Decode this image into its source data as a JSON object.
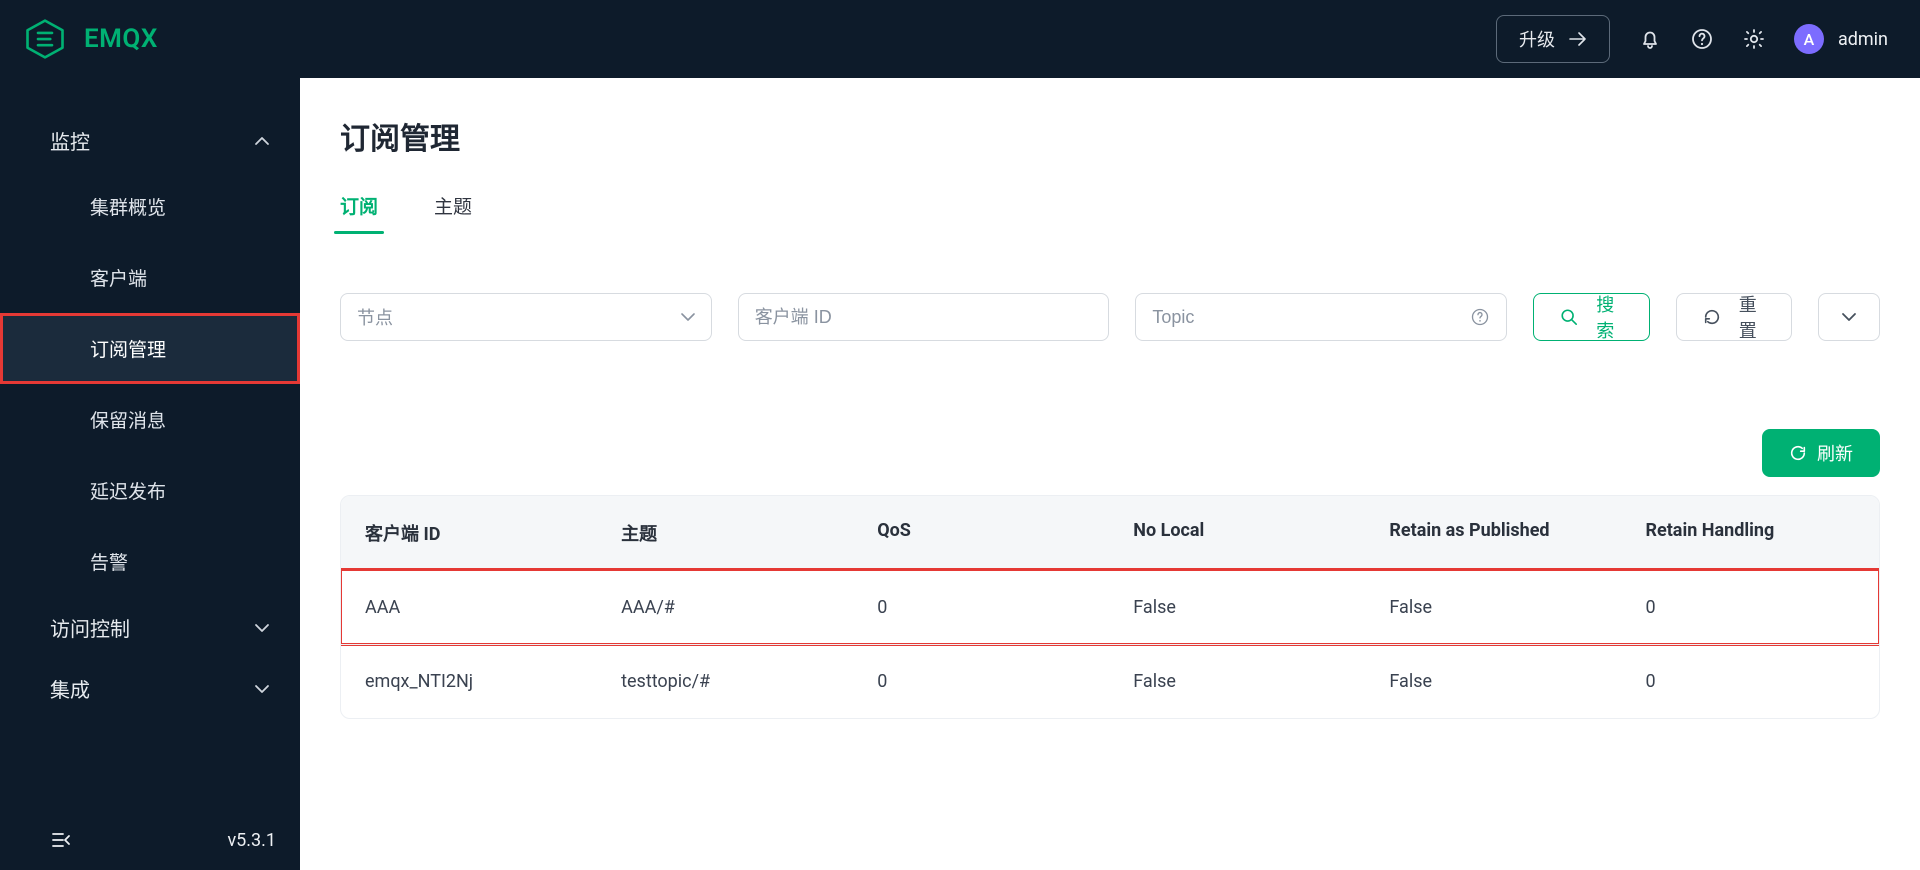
{
  "brand": {
    "name": "EMQX"
  },
  "header": {
    "upgrade_label": "升级",
    "user_initial": "A",
    "user_name": "admin"
  },
  "sidebar": {
    "sections": [
      {
        "label": "监控",
        "expanded": true,
        "items": [
          {
            "label": "集群概览"
          },
          {
            "label": "客户端"
          },
          {
            "label": "订阅管理",
            "active": true,
            "highlight": true
          },
          {
            "label": "保留消息"
          },
          {
            "label": "延迟发布"
          },
          {
            "label": "告警"
          }
        ]
      },
      {
        "label": "访问控制",
        "expanded": false
      },
      {
        "label": "集成",
        "expanded": false
      }
    ],
    "version": "v5.3.1"
  },
  "page": {
    "title": "订阅管理",
    "tabs": [
      {
        "label": "订阅",
        "active": true
      },
      {
        "label": "主题",
        "active": false
      }
    ],
    "filters": {
      "node_placeholder": "节点",
      "clientid_placeholder": "客户端 ID",
      "topic_placeholder": "Topic",
      "search_label": "搜索",
      "reset_label": "重置"
    },
    "refresh_label": "刷新",
    "table": {
      "columns": [
        "客户端 ID",
        "主题",
        "QoS",
        "No Local",
        "Retain as Published",
        "Retain Handling"
      ],
      "rows": [
        {
          "client_id": "AAA",
          "topic": "AAA/#",
          "qos": "0",
          "no_local": "False",
          "retain_as_published": "False",
          "retain_handling": "0",
          "highlight": true
        },
        {
          "client_id": "emqx_NTI2Nj",
          "topic": "testtopic/#",
          "qos": "0",
          "no_local": "False",
          "retain_as_published": "False",
          "retain_handling": "0"
        }
      ]
    }
  }
}
